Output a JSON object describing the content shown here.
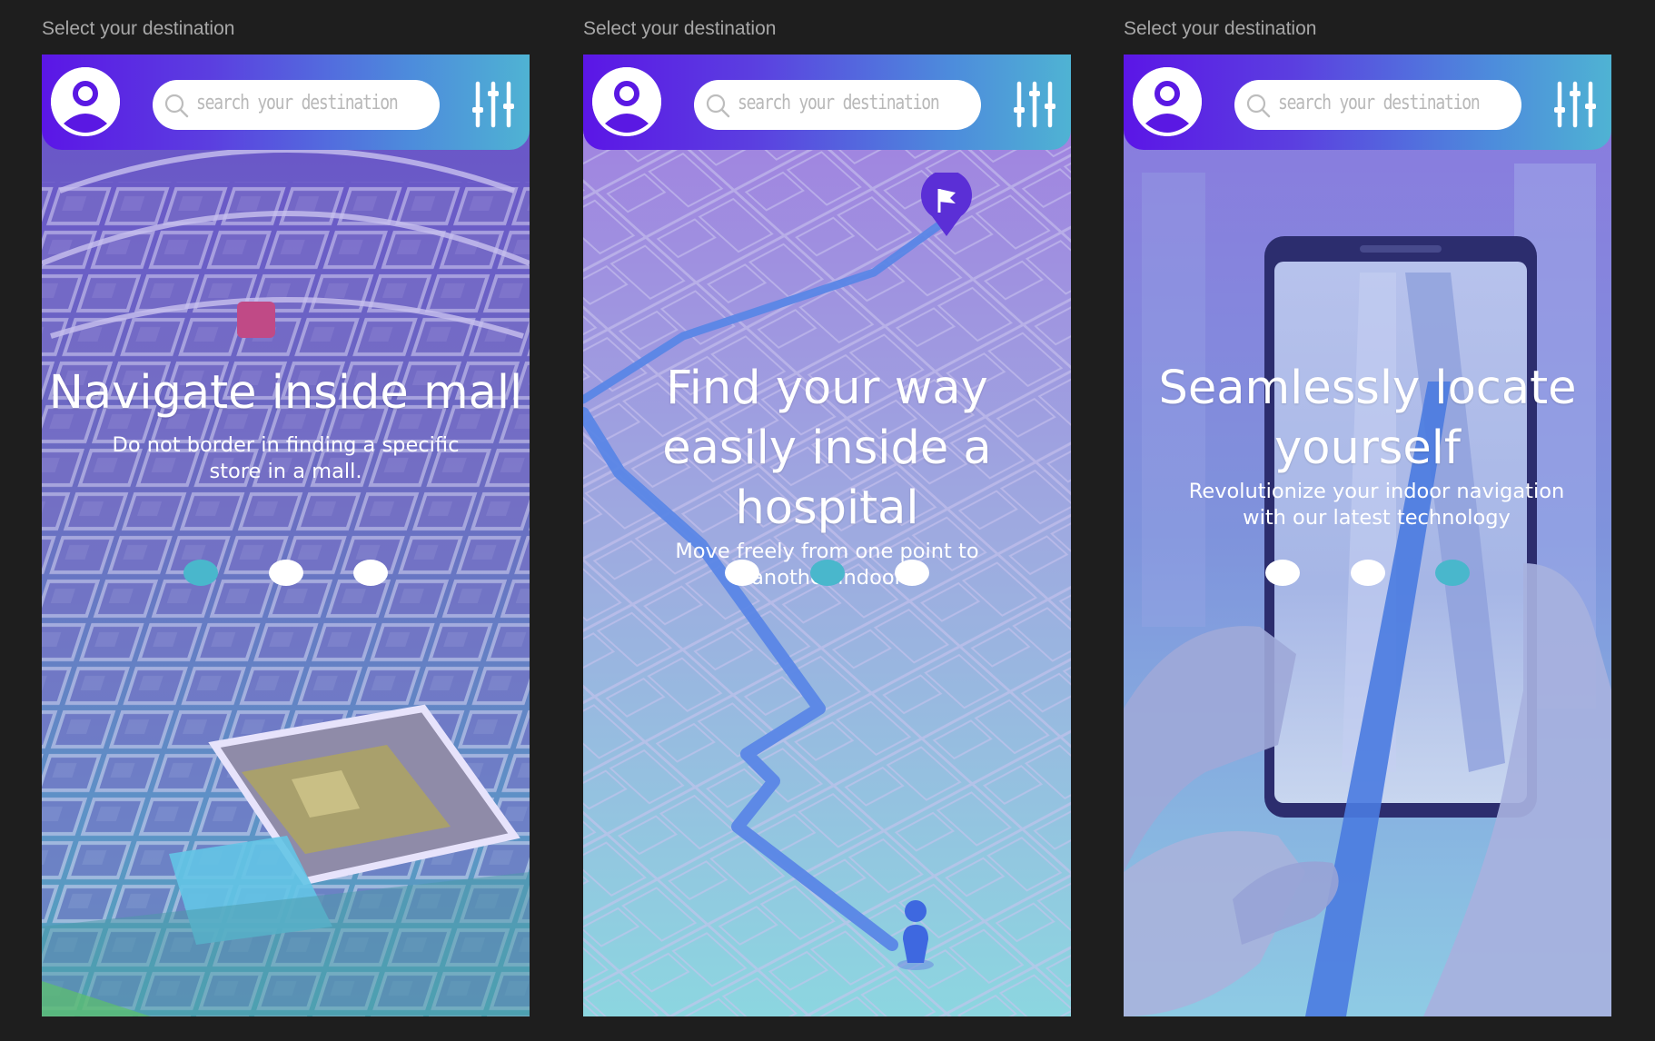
{
  "frame_label": "Select your destination",
  "search": {
    "placeholder": "search your destination"
  },
  "icons": {
    "profile": "user-circle-icon",
    "search": "magnifier-icon",
    "filter": "sliders-icon",
    "flag_pin": "flag-pin-icon",
    "person": "person-marker-icon"
  },
  "colors": {
    "header_start": "#5b16e6",
    "header_end": "#4fb3d3",
    "dot_active": "#49b7cc",
    "dot_inactive": "#ffffff",
    "background": "#1e1e1e"
  },
  "screens": [
    {
      "title": "Navigate inside mall",
      "description": "Do not border in finding a specific store in a mall.",
      "active_dot": 1,
      "dots": [
        "1",
        "2",
        "3"
      ]
    },
    {
      "title": "Find your way easily inside a hospital",
      "description": "Move freely from one point to another indoor",
      "active_dot": 2,
      "dots": [
        "1",
        "2",
        "3"
      ]
    },
    {
      "title": "Seamlessly locate yourself",
      "description": "Revolutionize your indoor navigation with our latest technology",
      "active_dot": 3,
      "dots": [
        "1",
        "2",
        "3"
      ]
    }
  ]
}
